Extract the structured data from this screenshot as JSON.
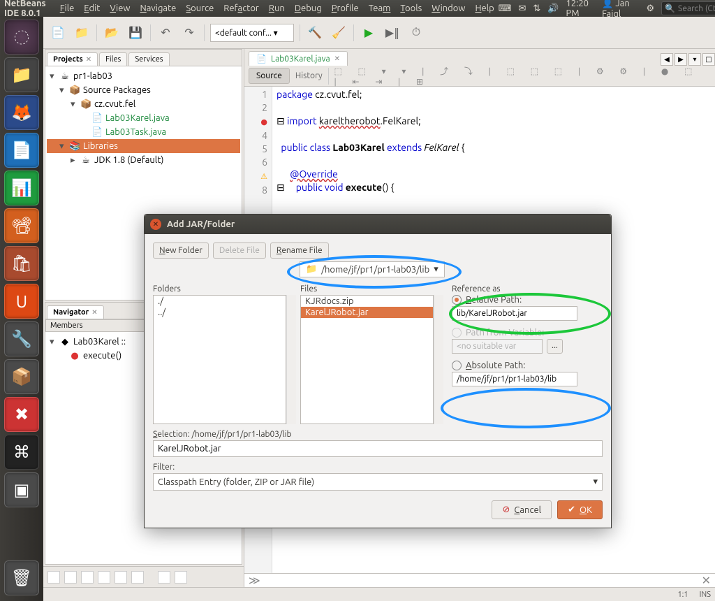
{
  "panel": {
    "app_title": "NetBeans IDE 8.0.1",
    "time": "12:20 PM",
    "user": "Jan Faigl",
    "search_placeholder": "Search (Ctrl+I)"
  },
  "menus": [
    "File",
    "Edit",
    "View",
    "Navigate",
    "Source",
    "Refactor",
    "Run",
    "Debug",
    "Profile",
    "Team",
    "Tools",
    "Window",
    "Help"
  ],
  "toolbar": {
    "config": "<default conf...  ▾"
  },
  "projects": {
    "tabs": [
      "Projects",
      "Files",
      "Services"
    ],
    "active_tab": "Projects",
    "root": "pr1-lab03",
    "source_packages": "Source Packages",
    "package": "cz.cvut.fel",
    "file1": "Lab03Karel.java",
    "file2": "Lab03Task.java",
    "libraries": "Libraries",
    "jdk": "JDK 1.8 (Default)"
  },
  "navigator": {
    "tab": "Navigator",
    "members": "Members",
    "class": "Lab03Karel ::",
    "method": "execute()"
  },
  "editor": {
    "tab": "Lab03Karel.java",
    "source_btn": "Source",
    "history_btn": "History",
    "lines": {
      "l1": "package cz.cvut.fel;",
      "l3": "import kareltherobot.FelKarel;",
      "l5a": "public class ",
      "l5b": "Lab03Karel",
      "l5c": " extends ",
      "l5d": "FelKarel",
      "l5e": " {",
      "l7": "@Override",
      "l8a": "public void ",
      "l8b": "execute",
      "l8c": "() {"
    }
  },
  "dialog": {
    "title": "Add JAR/Folder",
    "new_folder": "New Folder",
    "delete_file": "Delete File",
    "rename_file": "Rename File",
    "path": "/home/jf/pr1/pr1-lab03/lib",
    "folders_label": "Folders",
    "files_label": "Files",
    "reference_label": "Reference as",
    "folders": [
      "./",
      "../"
    ],
    "files": [
      "KJRdocs.zip",
      "KarelJRobot.jar"
    ],
    "selected_file": "KarelJRobot.jar",
    "relative_label": "Relative Path:",
    "relative_value": "lib/KarelJRobot.jar",
    "variable_label": "Path from Variable:",
    "variable_value": "<no suitable var",
    "absolute_label": "Absolute Path:",
    "absolute_value": "/home/jf/pr1/pr1-lab03/lib",
    "selection_label": "Selection: /home/jf/pr1/pr1-lab03/lib",
    "selection_value": "KarelJRobot.jar",
    "filter_label": "Filter:",
    "filter_value": "Classpath Entry (folder, ZIP or JAR file)",
    "cancel": "Cancel",
    "ok": "OK"
  },
  "status": {
    "pos": "1:1",
    "ins": "INS"
  }
}
